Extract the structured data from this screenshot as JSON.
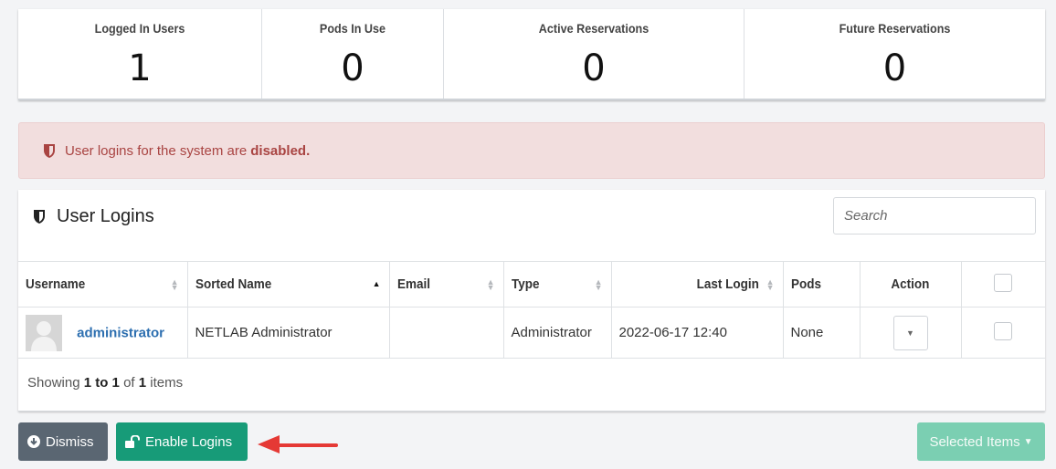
{
  "stats": [
    {
      "label": "Logged In Users",
      "value": "1"
    },
    {
      "label": "Pods In Use",
      "value": "0"
    },
    {
      "label": "Active Reservations",
      "value": "0"
    },
    {
      "label": "Future Reservations",
      "value": "0"
    }
  ],
  "alert": {
    "text": "User logins for the system are",
    "bold": "disabled."
  },
  "panel": {
    "title": "User Logins",
    "search_placeholder": "Search"
  },
  "table": {
    "headers": [
      "Username",
      "Sorted Name",
      "Email",
      "Type",
      "Last Login",
      "Pods",
      "Action"
    ],
    "rows": [
      {
        "username": "administrator",
        "sorted_name": "NETLAB Administrator",
        "email": "",
        "type": "Administrator",
        "last_login": "2022-06-17 12:40",
        "pods": "None"
      }
    ]
  },
  "footer": {
    "showing": "Showing",
    "range": "1 to 1",
    "of": "of",
    "total": "1",
    "items": "items"
  },
  "buttons": {
    "dismiss": "Dismiss",
    "enable_logins": "Enable Logins",
    "selected_items": "Selected Items"
  },
  "colors": {
    "alert_bg": "#f2dede",
    "alert_text": "#a94442",
    "link": "#2d6fb0",
    "enable_button": "#179b78",
    "dismiss_button": "#5a6672",
    "selected_button": "#7bcfb2",
    "arrow": "#e53935"
  }
}
